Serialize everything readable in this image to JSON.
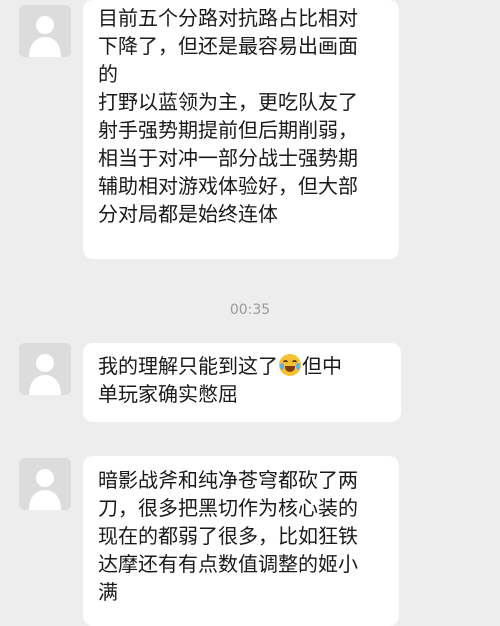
{
  "messages": [
    {
      "lines": [
        "目前五个分路对抗路占比相对",
        "下降了，但还是最容易出画面",
        "的",
        "打野以蓝领为主，更吃队友了",
        "射手强势期提前但后期削弱，",
        "相当于对冲一部分战士强势期",
        "辅助相对游戏体验好，但大部",
        "分对局都是始终连体"
      ]
    },
    {
      "line1_before": "我的理解只能到这了",
      "emoji": "loudly-crying-face-icon",
      "line1_after": "但中",
      "line2": "单玩家确实憋屈"
    },
    {
      "lines": [
        "暗影战斧和纯净苍穹都砍了两",
        "刀，很多把黑切作为核心装的",
        "现在的都弱了很多，比如狂铁",
        "达摩还有有点数值调整的姬小",
        "满"
      ]
    }
  ],
  "timestamp": "00:35",
  "colors": {
    "background": "#ededed",
    "bubble": "#ffffff",
    "avatar": "#dcdcdc"
  }
}
